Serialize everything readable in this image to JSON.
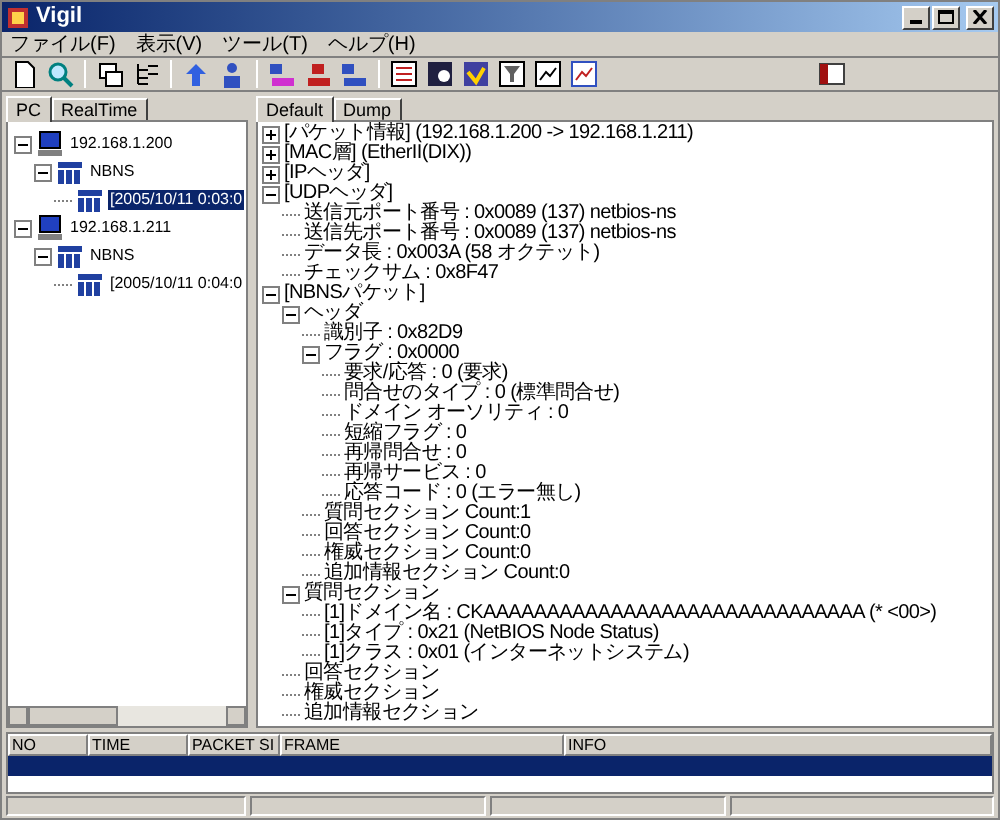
{
  "window": {
    "title": "Vigil"
  },
  "menu": [
    "ファイル(F)",
    "表示(V)",
    "ツール(T)",
    "ヘルプ(H)"
  ],
  "left_tabs": [
    {
      "label": "PC",
      "selected": true
    },
    {
      "label": "RealTime",
      "selected": false
    }
  ],
  "host_tree": [
    {
      "label": "192.168.1.200",
      "kind": "host",
      "selected": false,
      "expanded": true,
      "children": [
        {
          "label": "NBNS",
          "kind": "protocol",
          "selected": false,
          "expanded": true,
          "children": [
            {
              "label": "[2005/10/11 0:03:0",
              "kind": "protocol",
              "selected": true
            }
          ]
        }
      ]
    },
    {
      "label": "192.168.1.211",
      "kind": "host",
      "selected": false,
      "expanded": true,
      "children": [
        {
          "label": "NBNS",
          "kind": "protocol",
          "selected": false,
          "expanded": true,
          "children": [
            {
              "label": "[2005/10/11 0:04:0",
              "kind": "protocol",
              "selected": false
            }
          ]
        }
      ]
    }
  ],
  "right_tabs": [
    {
      "label": "Default",
      "selected": true
    },
    {
      "label": "Dump",
      "selected": false
    }
  ],
  "detail_tree": [
    {
      "label": "[パケット情報] (192.168.1.200 -> 192.168.1.211)",
      "expanded": false
    },
    {
      "label": "[MAC層] (EtherII(DIX))",
      "expanded": false
    },
    {
      "label": "[IPヘッダ]",
      "expanded": false
    },
    {
      "label": "[UDPヘッダ]",
      "expanded": true,
      "children": [
        {
          "label": "送信元ポート番号 : 0x0089 (137) netbios-ns"
        },
        {
          "label": "送信先ポート番号 : 0x0089 (137) netbios-ns"
        },
        {
          "label": "データ長 : 0x003A (58 オクテット)"
        },
        {
          "label": "チェックサム : 0x8F47"
        }
      ]
    },
    {
      "label": "[NBNSパケット]",
      "expanded": true,
      "children": [
        {
          "label": "ヘッダ",
          "expanded": true,
          "children": [
            {
              "label": "識別子 : 0x82D9"
            },
            {
              "label": "フラグ : 0x0000",
              "expanded": true,
              "children": [
                {
                  "label": "要求/応答 : 0 (要求)"
                },
                {
                  "label": "問合せのタイプ : 0 (標準問合せ)"
                },
                {
                  "label": "ドメイン オーソリティ : 0"
                },
                {
                  "label": "短縮フラグ : 0"
                },
                {
                  "label": "再帰問合せ : 0"
                },
                {
                  "label": "再帰サービス : 0"
                },
                {
                  "label": "応答コード : 0 (エラー無し)"
                }
              ]
            },
            {
              "label": "質問セクション Count:1"
            },
            {
              "label": "回答セクション Count:0"
            },
            {
              "label": "権威セクション Count:0"
            },
            {
              "label": "追加情報セクション Count:0"
            }
          ]
        },
        {
          "label": "質問セクション",
          "expanded": true,
          "children": [
            {
              "label": "[1]ドメイン名 : CKAAAAAAAAAAAAAAAAAAAAAAAAAAAAAA (* <00>)"
            },
            {
              "label": "[1]タイプ : 0x21 (NetBIOS Node Status)"
            },
            {
              "label": "[1]クラス : 0x01 (インターネットシステム)"
            }
          ]
        },
        {
          "label": "回答セクション"
        },
        {
          "label": "権威セクション"
        },
        {
          "label": "追加情報セクション"
        }
      ]
    }
  ],
  "packet_list": {
    "columns": [
      "NO",
      "TIME",
      "PACKET SI",
      "FRAME",
      "INFO"
    ],
    "rows": [
      {
        "selected": true
      }
    ]
  }
}
